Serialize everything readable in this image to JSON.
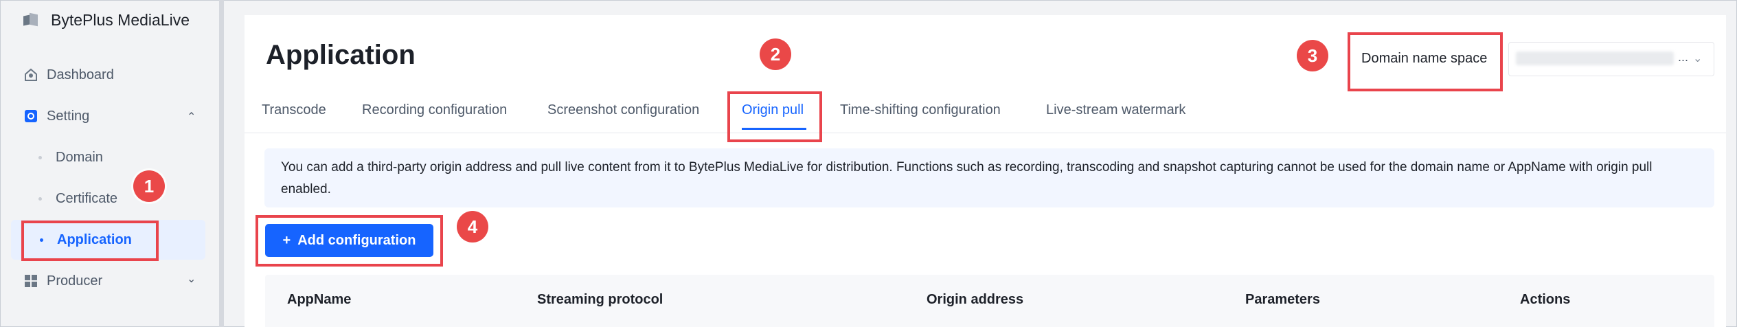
{
  "brand": {
    "name": "BytePlus MediaLive",
    "logo_icon": "cube-logo-icon"
  },
  "sidebar": {
    "dashboard": {
      "label": "Dashboard",
      "icon": "dashboard-icon"
    },
    "setting": {
      "label": "Setting",
      "icon": "setting-icon",
      "expanded": true,
      "children": [
        {
          "label": "Domain"
        },
        {
          "label": "Certificate"
        },
        {
          "label": "Application",
          "active": true
        }
      ]
    },
    "producer": {
      "label": "Producer",
      "icon": "grid-icon",
      "expanded": false
    }
  },
  "page": {
    "title": "Application"
  },
  "tabs": [
    {
      "label": "Transcode"
    },
    {
      "label": "Recording configuration"
    },
    {
      "label": "Screenshot configuration"
    },
    {
      "label": "Origin pull",
      "active": true
    },
    {
      "label": "Time-shifting configuration"
    },
    {
      "label": "Live-stream watermark"
    }
  ],
  "domain_space": {
    "label": "Domain name space",
    "value_ellipsis": "..."
  },
  "notice": {
    "line1": "You can add a third-party origin address and pull live content from it to BytePlus MediaLive for distribution. Functions such as recording, transcoding and snapshot capturing cannot be used for the domain name or AppName with origin pull",
    "line2": "enabled."
  },
  "add_button": {
    "plus": "+",
    "label": "Add configuration"
  },
  "table": {
    "columns": [
      "AppName",
      "Streaming protocol",
      "Origin address",
      "Parameters",
      "Actions"
    ]
  },
  "callouts": [
    "1",
    "2",
    "3",
    "4"
  ],
  "colors": {
    "accent": "#1664ff",
    "callout": "#e9444c",
    "notice_bg": "#f2f6ff"
  }
}
